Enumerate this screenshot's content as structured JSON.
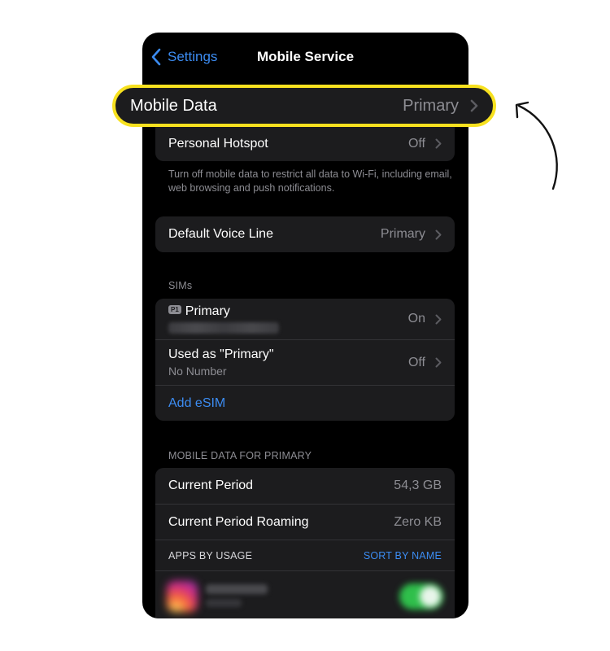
{
  "nav": {
    "back_label": "Settings",
    "title": "Mobile Service"
  },
  "mobile_data": {
    "label": "Mobile Data",
    "value": "Primary"
  },
  "hotspot": {
    "label": "Personal Hotspot",
    "value": "Off"
  },
  "mobile_data_footnote": "Turn off mobile data to restrict all data to Wi-Fi, including email, web browsing and push notifications.",
  "voice_line": {
    "label": "Default Voice Line",
    "value": "Primary"
  },
  "sims": {
    "header": "SIMs",
    "primary": {
      "badge": "P1",
      "label": "Primary",
      "value": "On"
    },
    "used_as": {
      "label": "Used as \"Primary\"",
      "sub": "No Number",
      "value": "Off"
    },
    "add_esim": "Add eSIM"
  },
  "usage": {
    "header": "MOBILE DATA FOR PRIMARY",
    "current_period": {
      "label": "Current Period",
      "value": "54,3 GB"
    },
    "roaming": {
      "label": "Current Period Roaming",
      "value": "Zero KB"
    },
    "apps_by_usage": "APPS BY USAGE",
    "sort_by_name": "SORT BY NAME"
  },
  "colors": {
    "accent": "#3c8cf2",
    "highlight": "#f7e11f",
    "cell_bg": "#1c1c1e",
    "secondary_text": "#8d8d93"
  },
  "icons": {
    "back": "chevron-left-icon",
    "disclosure": "chevron-right-icon",
    "annotation": "curved-arrow-icon",
    "app": "instagram-app-icon"
  }
}
